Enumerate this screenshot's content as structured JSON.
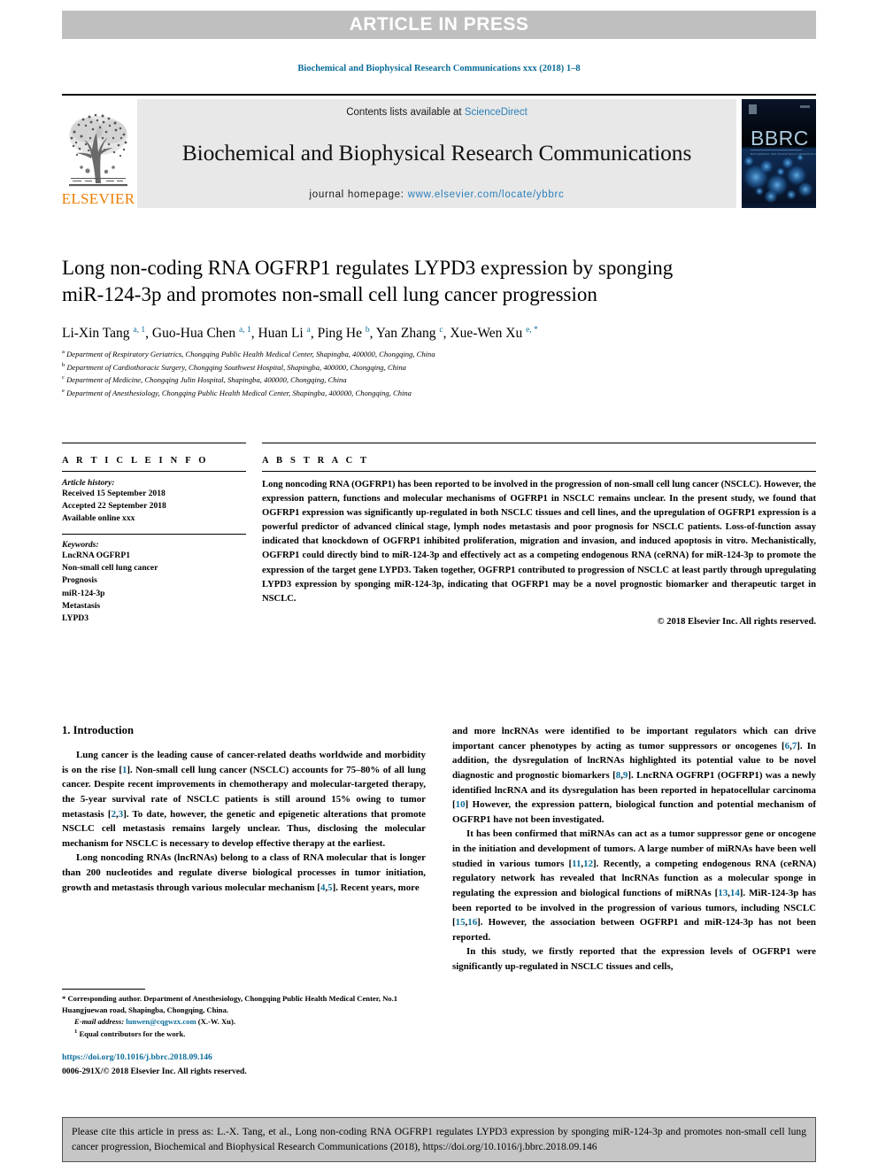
{
  "banner": {
    "label": "ARTICLE IN PRESS"
  },
  "running_head": "Biochemical and Biophysical Research Communications xxx (2018) 1–8",
  "masthead": {
    "publisher_name": "ELSEVIER",
    "contents_prefix": "Contents lists available at ",
    "contents_link": "ScienceDirect",
    "journal_title": "Biochemical and Biophysical Research Communications",
    "homepage_prefix": "journal homepage: ",
    "homepage_url": "www.elsevier.com/locate/ybbrc",
    "cover_title": "BBRC",
    "cover_subtitle": "BIOCHEMICAL AND BIOPHYSICAL RESEARCH COMMUNICATIONS",
    "colors": {
      "link": "#2a7fb8",
      "brand_orange": "#ef7d00",
      "panel": "#e8e8e8",
      "cover_bg": "#0a1730"
    }
  },
  "article": {
    "title": "Long non-coding RNA OGFRP1 regulates LYPD3 expression by sponging miR-124-3p and promotes non-small cell lung cancer progression",
    "authors": [
      {
        "name": "Li-Xin Tang",
        "marks": "a, 1"
      },
      {
        "name": "Guo-Hua Chen",
        "marks": "a, 1"
      },
      {
        "name": "Huan Li",
        "marks": "a"
      },
      {
        "name": "Ping He",
        "marks": "b"
      },
      {
        "name": "Yan Zhang",
        "marks": "c"
      },
      {
        "name": "Xue-Wen Xu",
        "marks": "e, *"
      }
    ],
    "affiliations": [
      {
        "mark": "a",
        "text": "Department of Respiratory Geriatrics, Chongqing Public Health Medical Center, Shapingba, 400000, Chongqing, China"
      },
      {
        "mark": "b",
        "text": "Department of Cardiothoracic Surgery, Chongqing Southwest Hospital, Shapingba, 400000, Chongqing, China"
      },
      {
        "mark": "c",
        "text": "Department of Medicine, Chongqing Julin Hospital, Shapingba, 400000, Chongqing, China"
      },
      {
        "mark": "e",
        "text": "Department of Anesthesiology, Chongqing Public Health Medical Center, Shapingba, 400000, Chongqing, China"
      }
    ]
  },
  "article_info": {
    "label": "A R T I C L E    I N F O",
    "history_heading": "Article history:",
    "history": [
      "Received 15 September 2018",
      "Accepted 22 September 2018",
      "Available online xxx"
    ],
    "keywords_heading": "Keywords:",
    "keywords": [
      "LncRNA OGFRP1",
      "Non-small cell lung cancer",
      "Prognosis",
      "miR-124-3p",
      "Metastasis",
      "LYPD3"
    ]
  },
  "abstract": {
    "label": "A B S T R A C T",
    "text": "Long noncoding RNA (OGFRP1) has been reported to be involved in the progression of non-small cell lung cancer (NSCLC). However, the expression pattern, functions and molecular mechanisms of OGFRP1 in NSCLC remains unclear. In the present study, we found that OGFRP1 expression was significantly up-regulated in both NSCLC tissues and cell lines, and the upregulation of OGFRP1 expression is a powerful predictor of advanced clinical stage, lymph nodes metastasis and poor prognosis for NSCLC patients. Loss-of-function assay indicated that knockdown of OGFRP1 inhibited proliferation, migration and invasion, and induced apoptosis in vitro. Mechanistically, OGFRP1 could directly bind to miR-124-3p and effectively act as a competing endogenous RNA (ceRNA) for miR-124-3p to promote the expression of the target gene LYPD3. Taken together, OGFRP1 contributed to progression of NSCLC at least partly through upregulating LYPD3 expression by sponging miR-124-3p, indicating that OGFRP1 may be a novel prognostic biomarker and therapeutic target in NSCLC.",
    "copyright": "© 2018 Elsevier Inc. All rights reserved."
  },
  "introduction": {
    "heading": "1. Introduction",
    "left_paragraphs": [
      "Lung cancer is the leading cause of cancer-related deaths worldwide and morbidity is on the rise [1]. Non-small cell lung cancer (NSCLC) accounts for 75–80% of all lung cancer. Despite recent improvements in chemotherapy and molecular-targeted therapy, the 5-year survival rate of NSCLC patients is still around 15% owing to tumor metastasis [2,3]. To date, however, the genetic and epigenetic alterations that promote NSCLC cell metastasis remains largely unclear. Thus, disclosing the molecular mechanism for NSCLC is necessary to develop effective therapy at the earliest.",
      "Long noncoding RNAs (lncRNAs) belong to a class of RNA molecular that is longer than 200 nucleotides and regulate diverse biological processes in tumor initiation, growth and metastasis through various molecular mechanism [4,5]. Recent years, more"
    ],
    "right_paragraphs": [
      "and more lncRNAs were identified to be important regulators which can drive important cancer phenotypes by acting as tumor suppressors or oncogenes [6,7]. In addition, the dysregulation of lncRNAs highlighted its potential value to be novel diagnostic and prognostic biomarkers [8,9]. LncRNA OGFRP1 (OGFRP1) was a newly identified lncRNA and its dysregulation has been reported in hepatocellular carcinoma [10] However, the expression pattern, biological function and potential mechanism of OGFRP1 have not been investigated.",
      "It has been confirmed that miRNAs can act as a tumor suppressor gene or oncogene in the initiation and development of tumors. A large number of miRNAs have been well studied in various tumors [11,12]. Recently, a competing endogenous RNA (ceRNA) regulatory network has revealed that lncRNAs function as a molecular sponge in regulating the expression and biological functions of miRNAs [13,14]. MiR-124-3p has been reported to be involved in the progression of various tumors, including NSCLC [15,16]. However, the association between OGFRP1 and miR-124-3p has not been reported.",
      "In this study, we firstly reported that the expression levels of OGFRP1 were significantly up-regulated in NSCLC tissues and cells,"
    ]
  },
  "footnotes": {
    "corresponding": "* Corresponding author. Department of Anesthesiology, Chongqing Public Health Medical Center, No.1 Huangjuewan road, Shapingba, Chongqing, China.",
    "email_label": "E-mail address:",
    "email": "lunwen@cqgwzx.com",
    "email_attrib": "(X.-W. Xu).",
    "equal_mark": "1",
    "equal_contrib": "Equal contributors for the work.",
    "doi": "https://doi.org/10.1016/j.bbrc.2018.09.146",
    "issn_copyright": "0006-291X/© 2018 Elsevier Inc. All rights reserved."
  },
  "cite_box": {
    "text": "Please cite this article in press as: L.-X. Tang, et al., Long non-coding RNA OGFRP1 regulates LYPD3 expression by sponging miR-124-3p and promotes non-small cell lung cancer progression, Biochemical and Biophysical Research Communications (2018), https://doi.org/10.1016/j.bbrc.2018.09.146"
  }
}
